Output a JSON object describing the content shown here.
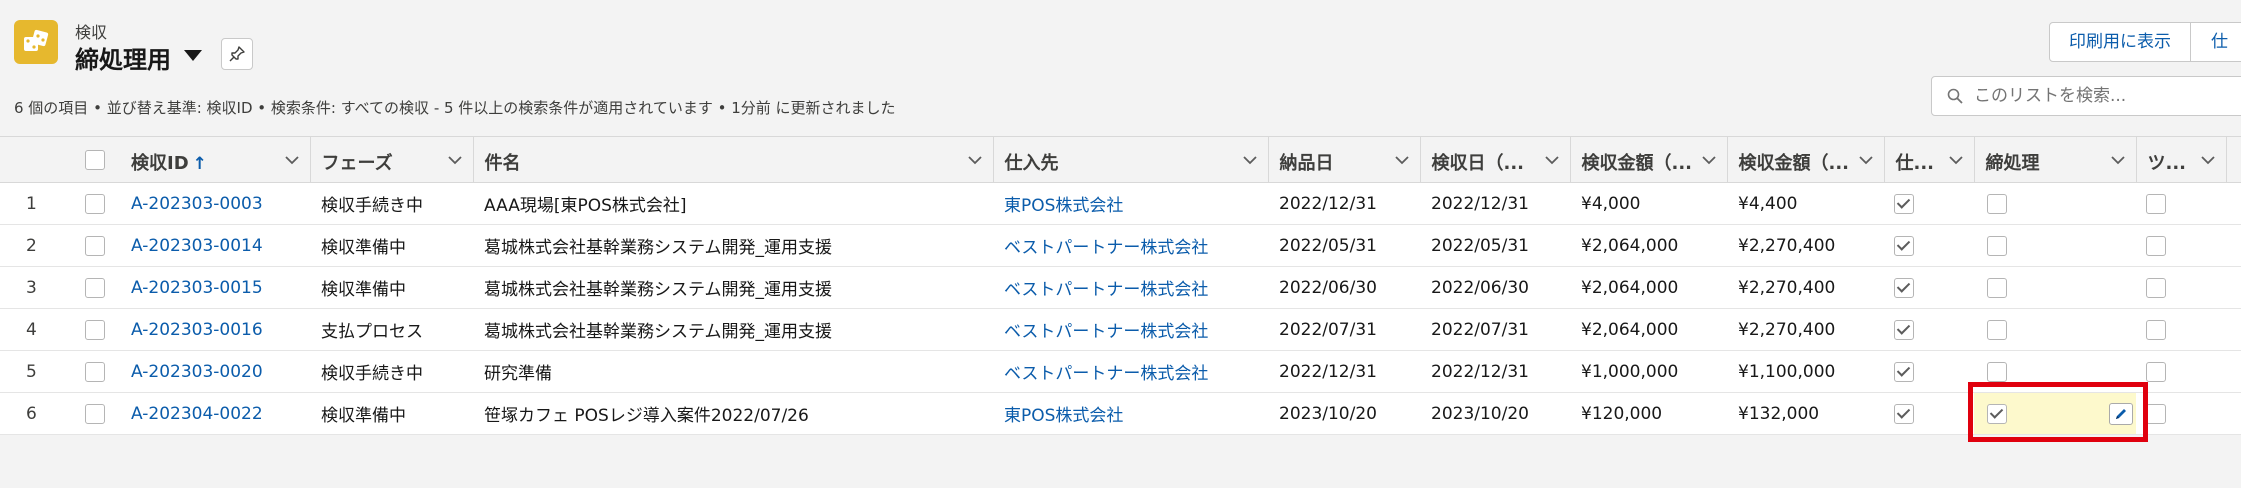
{
  "header": {
    "object_label": "検収",
    "view_title": "締処理用",
    "status_line": "6 個の項目 • 並び替え基準: 検収ID • 検索条件: すべての検収 - 5 件以上の検索条件が適用されています • 1分前 に更新されました",
    "print_button": "印刷用に表示",
    "second_button": "仕",
    "search_placeholder": "このリストを検索...",
    "icons": {
      "object": "dice-icon",
      "pin": "pin-icon",
      "search": "search-icon"
    }
  },
  "columns": [
    {
      "label": "検収ID",
      "sorted": "ascending",
      "sort_icon": "↑"
    },
    {
      "label": "フェーズ"
    },
    {
      "label": "件名"
    },
    {
      "label": "仕入先"
    },
    {
      "label": "納品日"
    },
    {
      "label": "検収日（..."
    },
    {
      "label": "検収金額（..."
    },
    {
      "label": "検収金額（..."
    },
    {
      "label": "仕..."
    },
    {
      "label": "締処理"
    },
    {
      "label": "ツ..."
    }
  ],
  "rows": [
    {
      "num": "1",
      "id": "A-202303-0003",
      "phase": "検収手続き中",
      "subject": "AAA現場[東POS株式会社]",
      "vendor": "東POS株式会社",
      "delivery_date": "2022/12/31",
      "inspection_date": "2022/12/31",
      "amount1": "¥4,000",
      "amount2": "¥4,400",
      "col_shi": true,
      "closing": false,
      "col_tsu": false
    },
    {
      "num": "2",
      "id": "A-202303-0014",
      "phase": "検収準備中",
      "subject": "葛城株式会社基幹業務システム開発_運用支援",
      "vendor": "ベストパートナー株式会社",
      "delivery_date": "2022/05/31",
      "inspection_date": "2022/05/31",
      "amount1": "¥2,064,000",
      "amount2": "¥2,270,400",
      "col_shi": true,
      "closing": false,
      "col_tsu": false
    },
    {
      "num": "3",
      "id": "A-202303-0015",
      "phase": "検収準備中",
      "subject": "葛城株式会社基幹業務システム開発_運用支援",
      "vendor": "ベストパートナー株式会社",
      "delivery_date": "2022/06/30",
      "inspection_date": "2022/06/30",
      "amount1": "¥2,064,000",
      "amount2": "¥2,270,400",
      "col_shi": true,
      "closing": false,
      "col_tsu": false
    },
    {
      "num": "4",
      "id": "A-202303-0016",
      "phase": "支払プロセス",
      "subject": "葛城株式会社基幹業務システム開発_運用支援",
      "vendor": "ベストパートナー株式会社",
      "delivery_date": "2022/07/31",
      "inspection_date": "2022/07/31",
      "amount1": "¥2,064,000",
      "amount2": "¥2,270,400",
      "col_shi": true,
      "closing": false,
      "col_tsu": false
    },
    {
      "num": "5",
      "id": "A-202303-0020",
      "phase": "検収手続き中",
      "subject": "研究準備",
      "vendor": "ベストパートナー株式会社",
      "delivery_date": "2022/12/31",
      "inspection_date": "2022/12/31",
      "amount1": "¥1,000,000",
      "amount2": "¥1,100,000",
      "col_shi": true,
      "closing": false,
      "col_tsu": false
    },
    {
      "num": "6",
      "id": "A-202304-0022",
      "phase": "検収準備中",
      "subject": "笹塚カフェ POSレジ導入案件2022/07/26",
      "vendor": "東POS株式会社",
      "delivery_date": "2023/10/20",
      "inspection_date": "2023/10/20",
      "amount1": "¥120,000",
      "amount2": "¥132,000",
      "col_shi": true,
      "closing": true,
      "closing_edited": true,
      "col_tsu": false
    }
  ],
  "colors": {
    "link": "#0b5cab",
    "object_icon": "#e6b82e",
    "edited_cell": "#fdf9cc",
    "highlight": "#e0000e"
  }
}
